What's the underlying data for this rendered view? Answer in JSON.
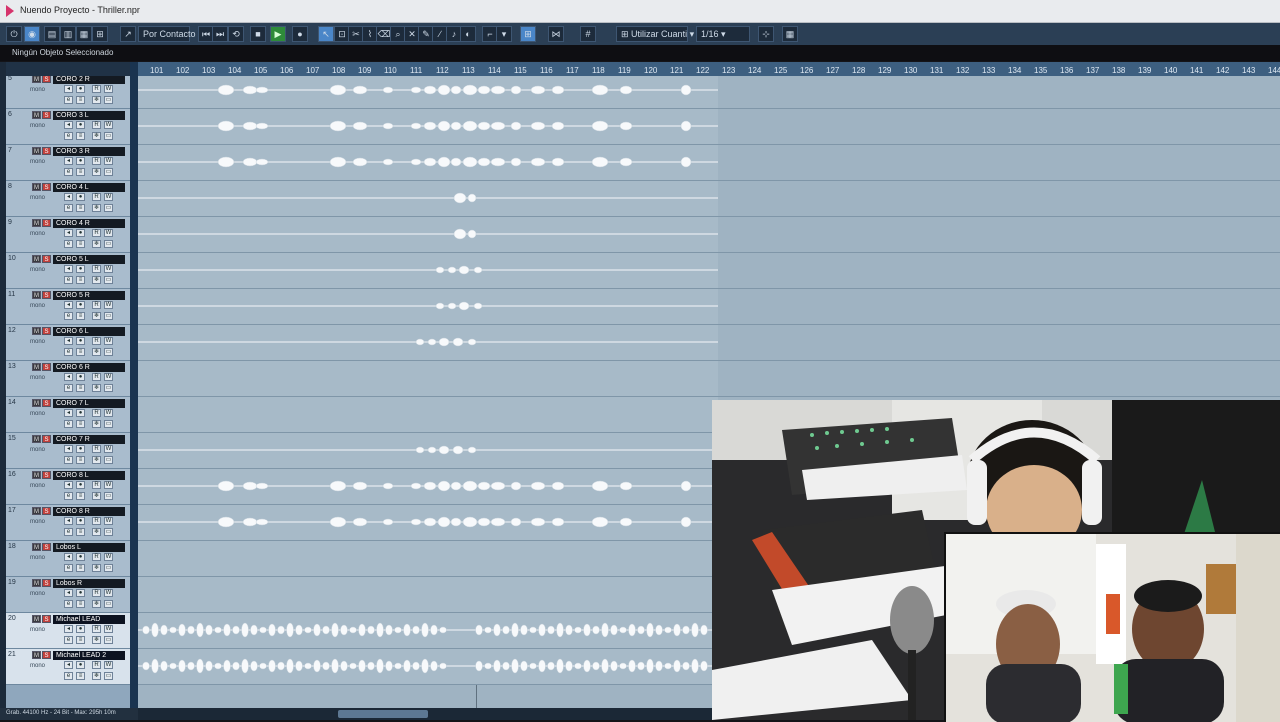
{
  "window": {
    "title": "Nuendo Proyecto - Thriller.npr"
  },
  "toolbar": {
    "contact_mode": "Por Contacto",
    "quantize_mode": "Utilizar Cuanti",
    "quantize_value": "1/16"
  },
  "status": {
    "selection": "Ningún Objeto Seleccionado"
  },
  "ruler": {
    "bars": [
      "101",
      "102",
      "103",
      "104",
      "105",
      "106",
      "107",
      "108",
      "109",
      "110",
      "111",
      "112",
      "113",
      "114",
      "115",
      "116",
      "117",
      "118",
      "119",
      "120",
      "121",
      "122",
      "123",
      "124",
      "125",
      "126",
      "127",
      "128",
      "129",
      "130",
      "131",
      "132",
      "133",
      "134",
      "135",
      "136",
      "137",
      "138",
      "139",
      "140",
      "141",
      "142",
      "143",
      "144"
    ]
  },
  "tracks": [
    {
      "num": "5",
      "name": "CORO 2 R",
      "type": "mono",
      "wave": "full"
    },
    {
      "num": "6",
      "name": "CORO 3 L",
      "type": "mono",
      "wave": "full"
    },
    {
      "num": "7",
      "name": "CORO 3 R",
      "type": "mono",
      "wave": "full"
    },
    {
      "num": "8",
      "name": "CORO 4 L",
      "type": "mono",
      "wave": "blip"
    },
    {
      "num": "9",
      "name": "CORO 4 R",
      "type": "mono",
      "wave": "blip"
    },
    {
      "num": "10",
      "name": "CORO 5 L",
      "type": "mono",
      "wave": "short"
    },
    {
      "num": "11",
      "name": "CORO 5 R",
      "type": "mono",
      "wave": "short"
    },
    {
      "num": "12",
      "name": "CORO 6 L",
      "type": "mono",
      "wave": "mid"
    },
    {
      "num": "13",
      "name": "CORO 6 R",
      "type": "mono",
      "wave": "none"
    },
    {
      "num": "14",
      "name": "CORO 7 L",
      "type": "mono",
      "wave": "none"
    },
    {
      "num": "15",
      "name": "CORO 7 R",
      "type": "mono",
      "wave": "mid"
    },
    {
      "num": "16",
      "name": "CORO 8 L",
      "type": "mono",
      "wave": "full"
    },
    {
      "num": "17",
      "name": "CORO 8 R",
      "type": "mono",
      "wave": "full"
    },
    {
      "num": "18",
      "name": "Lobos L",
      "type": "mono",
      "wave": "none"
    },
    {
      "num": "19",
      "name": "Lobos R",
      "type": "mono",
      "wave": "none"
    },
    {
      "num": "20",
      "name": "Michael LEAD",
      "type": "mono",
      "wave": "lead"
    },
    {
      "num": "21",
      "name": "Michael LEAD 2",
      "type": "mono",
      "wave": "lead"
    }
  ],
  "track_controls": {
    "mute": "M",
    "solo": "S",
    "read": "R",
    "write": "W",
    "monitor": "◂",
    "edit": "e"
  },
  "statusbar": {
    "text": "Grab. 44100 Hz - 24 Bit - Max: 295h 10m"
  },
  "colors": {
    "arrange_bg": "#9fb3c2",
    "event_bg": "#a7bac8",
    "ruler": "#3d5f80",
    "toolbar": "#2b3f55",
    "solo": "#c0403c"
  }
}
